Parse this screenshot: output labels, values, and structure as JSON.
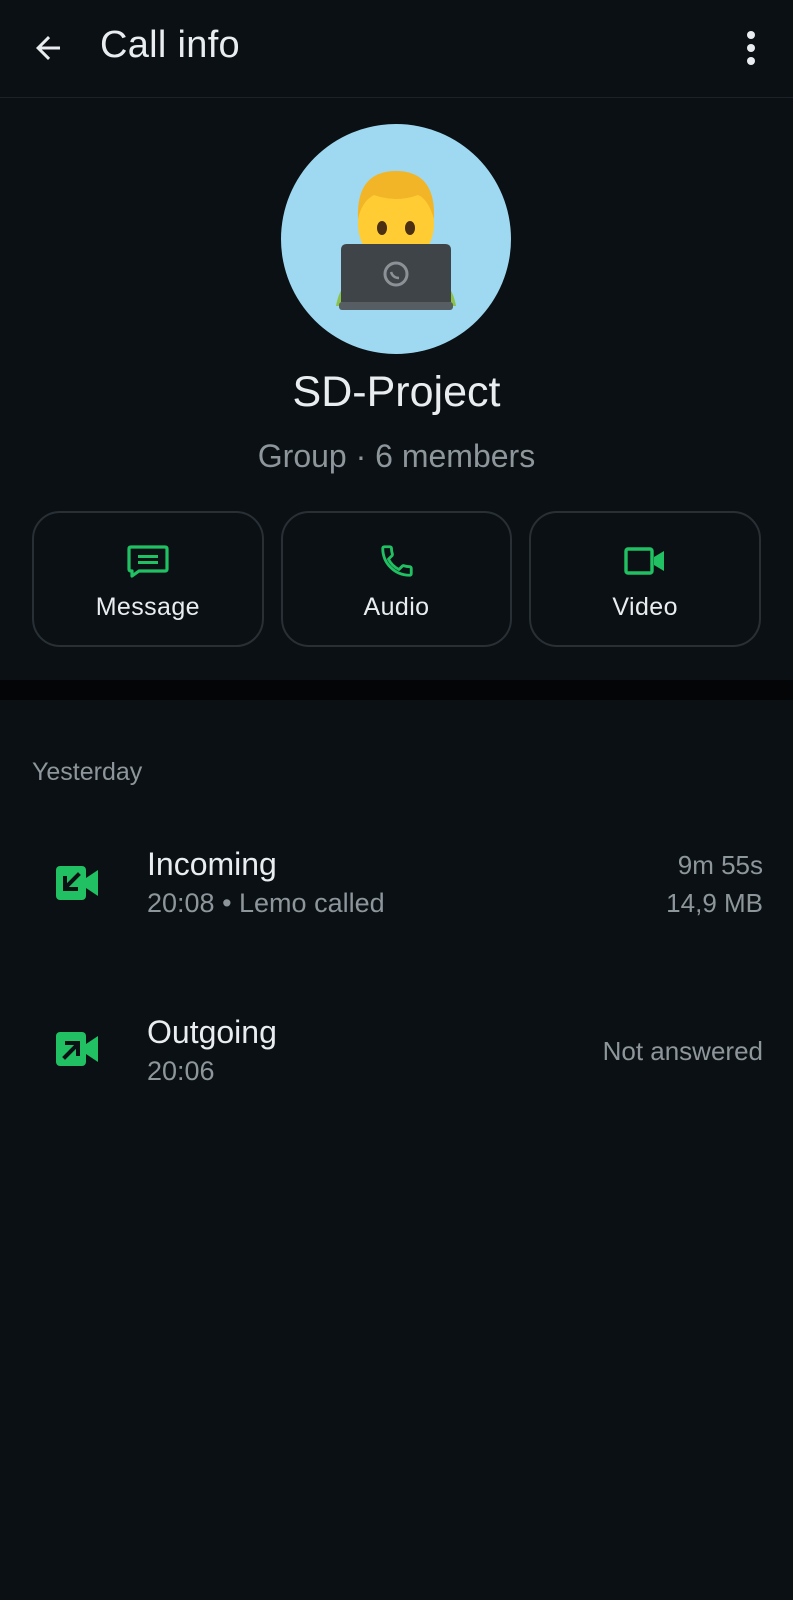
{
  "header": {
    "title": "Call info",
    "back_icon": "arrow-left-icon",
    "menu_icon": "more-vertical-icon"
  },
  "profile": {
    "avatar_icon": "technologist-laptop-emoji",
    "name": "SD-Project",
    "meta": "Group · 6 members"
  },
  "actions": [
    {
      "label": "Message",
      "icon": "message-icon"
    },
    {
      "label": "Audio",
      "icon": "phone-icon"
    },
    {
      "label": "Video",
      "icon": "video-camera-icon"
    }
  ],
  "section": {
    "label": "Yesterday"
  },
  "calls": [
    {
      "type": "Incoming",
      "detail": "20:08 • Lemo called",
      "duration": "9m 55s",
      "size": "14,9 MB",
      "icon": "incoming-video-call-icon"
    },
    {
      "type": "Outgoing",
      "detail": "20:06",
      "status": "Not answered",
      "icon": "outgoing-video-call-icon"
    }
  ],
  "colors": {
    "background": "#0b1014",
    "accent": "#21c063",
    "muted": "#8d969b"
  }
}
